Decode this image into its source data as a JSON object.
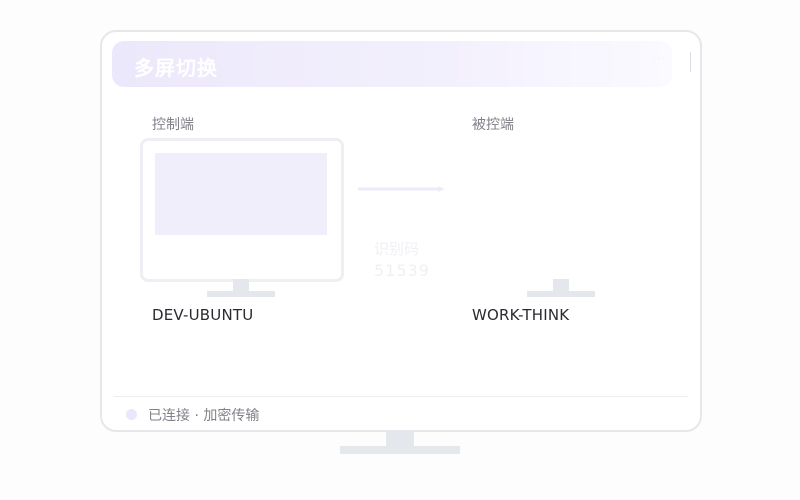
{
  "window": {
    "title": "多屏切换"
  },
  "controller": {
    "label": "控制端",
    "device_name": "DEV-UBUNTU"
  },
  "controlled": {
    "label": "被控端",
    "device_name": "WORK-THINK"
  },
  "pairing": {
    "code_label": "识别码",
    "code_value": "51539"
  },
  "status": {
    "text": "已连接 · 加密传输"
  },
  "icons": {
    "controller_screen": "monitor-icon",
    "controlled_screen": "monitor-icon",
    "direction": "arrow-right-icon",
    "status_dot": "dot-icon",
    "more": "more-icon"
  },
  "colors": {
    "accent": "#f1eefc",
    "banner_start": "#ece8fb",
    "status_dot": "#ebe6fb",
    "device_text": "#2a2b30"
  }
}
